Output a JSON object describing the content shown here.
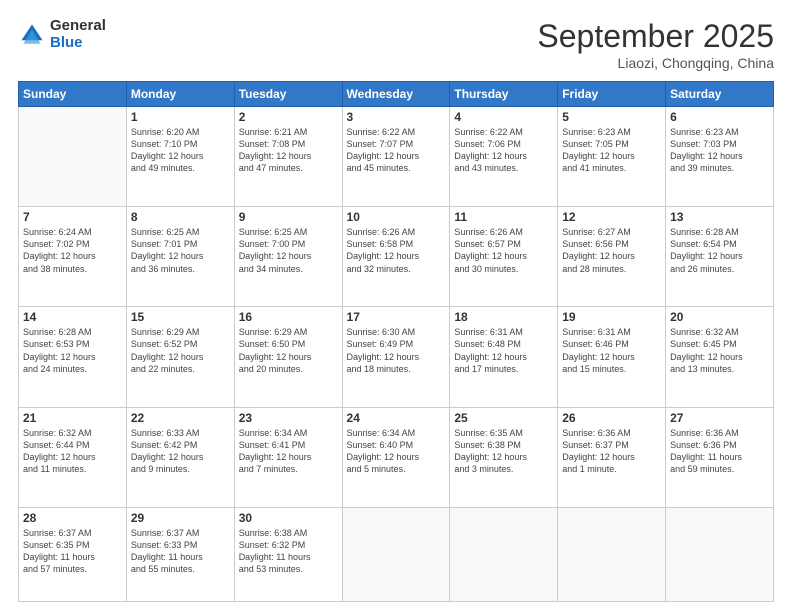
{
  "logo": {
    "general": "General",
    "blue": "Blue"
  },
  "header": {
    "month": "September 2025",
    "location": "Liaozi, Chongqing, China"
  },
  "days_of_week": [
    "Sunday",
    "Monday",
    "Tuesday",
    "Wednesday",
    "Thursday",
    "Friday",
    "Saturday"
  ],
  "weeks": [
    [
      {
        "day": "",
        "info": ""
      },
      {
        "day": "1",
        "info": "Sunrise: 6:20 AM\nSunset: 7:10 PM\nDaylight: 12 hours\nand 49 minutes."
      },
      {
        "day": "2",
        "info": "Sunrise: 6:21 AM\nSunset: 7:08 PM\nDaylight: 12 hours\nand 47 minutes."
      },
      {
        "day": "3",
        "info": "Sunrise: 6:22 AM\nSunset: 7:07 PM\nDaylight: 12 hours\nand 45 minutes."
      },
      {
        "day": "4",
        "info": "Sunrise: 6:22 AM\nSunset: 7:06 PM\nDaylight: 12 hours\nand 43 minutes."
      },
      {
        "day": "5",
        "info": "Sunrise: 6:23 AM\nSunset: 7:05 PM\nDaylight: 12 hours\nand 41 minutes."
      },
      {
        "day": "6",
        "info": "Sunrise: 6:23 AM\nSunset: 7:03 PM\nDaylight: 12 hours\nand 39 minutes."
      }
    ],
    [
      {
        "day": "7",
        "info": "Sunrise: 6:24 AM\nSunset: 7:02 PM\nDaylight: 12 hours\nand 38 minutes."
      },
      {
        "day": "8",
        "info": "Sunrise: 6:25 AM\nSunset: 7:01 PM\nDaylight: 12 hours\nand 36 minutes."
      },
      {
        "day": "9",
        "info": "Sunrise: 6:25 AM\nSunset: 7:00 PM\nDaylight: 12 hours\nand 34 minutes."
      },
      {
        "day": "10",
        "info": "Sunrise: 6:26 AM\nSunset: 6:58 PM\nDaylight: 12 hours\nand 32 minutes."
      },
      {
        "day": "11",
        "info": "Sunrise: 6:26 AM\nSunset: 6:57 PM\nDaylight: 12 hours\nand 30 minutes."
      },
      {
        "day": "12",
        "info": "Sunrise: 6:27 AM\nSunset: 6:56 PM\nDaylight: 12 hours\nand 28 minutes."
      },
      {
        "day": "13",
        "info": "Sunrise: 6:28 AM\nSunset: 6:54 PM\nDaylight: 12 hours\nand 26 minutes."
      }
    ],
    [
      {
        "day": "14",
        "info": "Sunrise: 6:28 AM\nSunset: 6:53 PM\nDaylight: 12 hours\nand 24 minutes."
      },
      {
        "day": "15",
        "info": "Sunrise: 6:29 AM\nSunset: 6:52 PM\nDaylight: 12 hours\nand 22 minutes."
      },
      {
        "day": "16",
        "info": "Sunrise: 6:29 AM\nSunset: 6:50 PM\nDaylight: 12 hours\nand 20 minutes."
      },
      {
        "day": "17",
        "info": "Sunrise: 6:30 AM\nSunset: 6:49 PM\nDaylight: 12 hours\nand 18 minutes."
      },
      {
        "day": "18",
        "info": "Sunrise: 6:31 AM\nSunset: 6:48 PM\nDaylight: 12 hours\nand 17 minutes."
      },
      {
        "day": "19",
        "info": "Sunrise: 6:31 AM\nSunset: 6:46 PM\nDaylight: 12 hours\nand 15 minutes."
      },
      {
        "day": "20",
        "info": "Sunrise: 6:32 AM\nSunset: 6:45 PM\nDaylight: 12 hours\nand 13 minutes."
      }
    ],
    [
      {
        "day": "21",
        "info": "Sunrise: 6:32 AM\nSunset: 6:44 PM\nDaylight: 12 hours\nand 11 minutes."
      },
      {
        "day": "22",
        "info": "Sunrise: 6:33 AM\nSunset: 6:42 PM\nDaylight: 12 hours\nand 9 minutes."
      },
      {
        "day": "23",
        "info": "Sunrise: 6:34 AM\nSunset: 6:41 PM\nDaylight: 12 hours\nand 7 minutes."
      },
      {
        "day": "24",
        "info": "Sunrise: 6:34 AM\nSunset: 6:40 PM\nDaylight: 12 hours\nand 5 minutes."
      },
      {
        "day": "25",
        "info": "Sunrise: 6:35 AM\nSunset: 6:38 PM\nDaylight: 12 hours\nand 3 minutes."
      },
      {
        "day": "26",
        "info": "Sunrise: 6:36 AM\nSunset: 6:37 PM\nDaylight: 12 hours\nand 1 minute."
      },
      {
        "day": "27",
        "info": "Sunrise: 6:36 AM\nSunset: 6:36 PM\nDaylight: 11 hours\nand 59 minutes."
      }
    ],
    [
      {
        "day": "28",
        "info": "Sunrise: 6:37 AM\nSunset: 6:35 PM\nDaylight: 11 hours\nand 57 minutes."
      },
      {
        "day": "29",
        "info": "Sunrise: 6:37 AM\nSunset: 6:33 PM\nDaylight: 11 hours\nand 55 minutes."
      },
      {
        "day": "30",
        "info": "Sunrise: 6:38 AM\nSunset: 6:32 PM\nDaylight: 11 hours\nand 53 minutes."
      },
      {
        "day": "",
        "info": ""
      },
      {
        "day": "",
        "info": ""
      },
      {
        "day": "",
        "info": ""
      },
      {
        "day": "",
        "info": ""
      }
    ]
  ]
}
